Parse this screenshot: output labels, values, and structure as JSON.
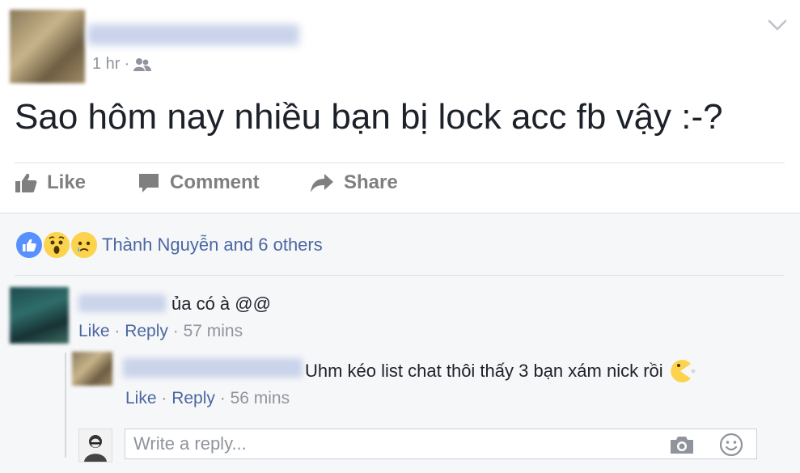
{
  "post": {
    "time": "1 hr",
    "separator": "·",
    "text": "Sao hôm nay nhiều bạn bị lock acc fb vậy :-?"
  },
  "actions": {
    "like": "Like",
    "comment": "Comment",
    "share": "Share"
  },
  "reactions": {
    "icons": [
      "like-icon",
      "wow-icon",
      "sad-icon"
    ],
    "summary": "Thành Nguyễn and 6 others"
  },
  "comments": [
    {
      "text": "ủa có à @@",
      "like": "Like",
      "reply": "Reply",
      "time": "57 mins"
    },
    {
      "text": "Uhm kéo list chat thôi thấy 3 bạn xám nick rồi",
      "emoji": "pacman-emoticon",
      "like": "Like",
      "reply": "Reply",
      "time": "56 mins"
    }
  ],
  "reply_box": {
    "placeholder": "Write a reply...",
    "icons": [
      "camera-icon",
      "smile-icon"
    ]
  },
  "colors": {
    "link": "#4b67a1",
    "meta": "#90949c",
    "like_blue": "#5890ff",
    "emoji_yellow": "#fcd34d"
  }
}
